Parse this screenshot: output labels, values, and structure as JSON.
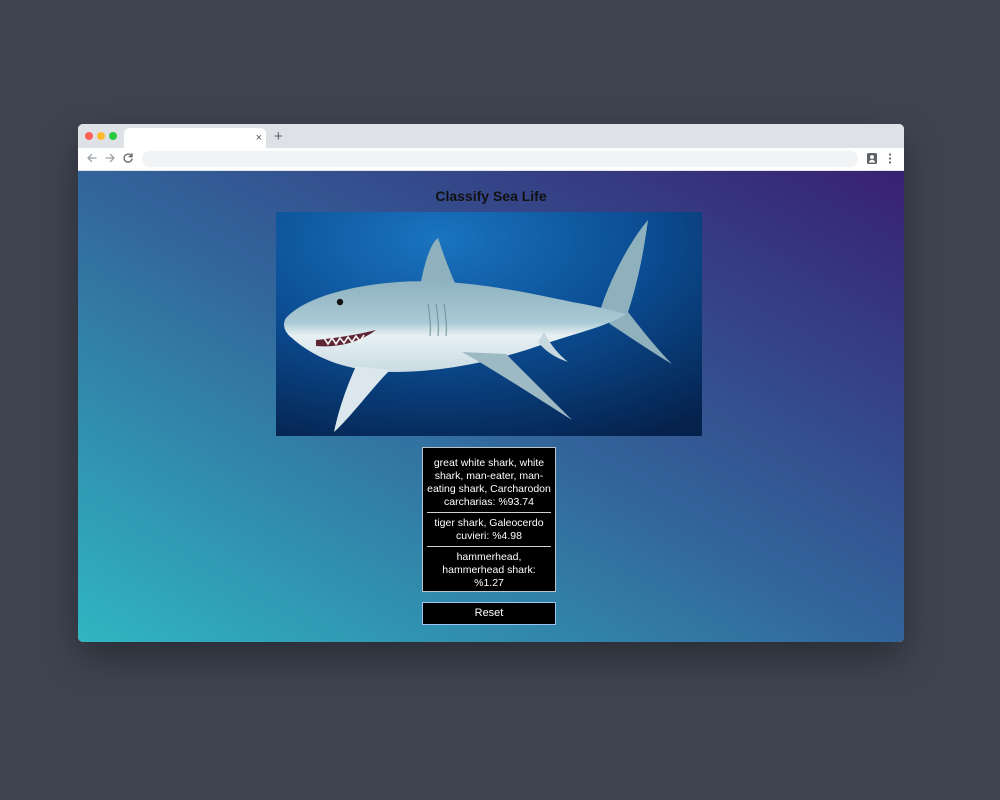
{
  "browser": {
    "tab_title": "",
    "tab_close": "×",
    "new_tab": "+",
    "address": ""
  },
  "app": {
    "title": "Classify Sea Life",
    "image_subject": "great white shark photo",
    "predictions": [
      {
        "label": "great white shark, white shark, man-eater, man-eating shark, Carcharodon carcharias: %93.74"
      },
      {
        "label": "tiger shark, Galeocerdo cuvieri: %4.98"
      },
      {
        "label": "hammerhead, hammerhead shark: %1.27"
      }
    ],
    "reset_label": "Reset"
  },
  "colors": {
    "desktop": "#3f4451",
    "gradient_start": "#30b6c1",
    "gradient_end": "#382172",
    "panel": "#000000"
  }
}
